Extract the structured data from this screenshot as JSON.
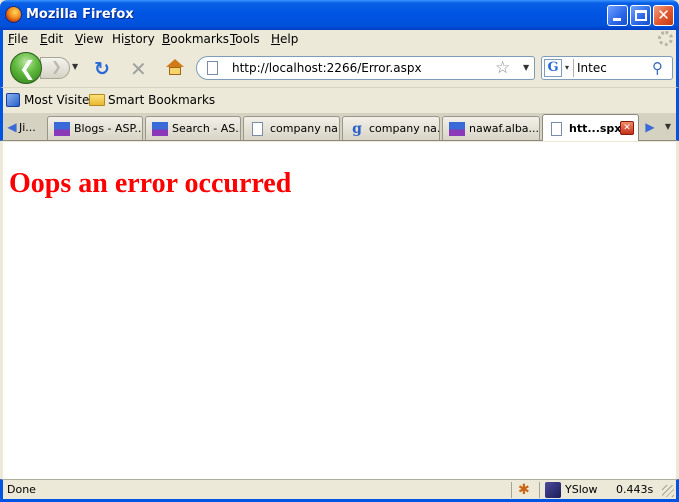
{
  "window": {
    "title": "Mozilla Firefox",
    "close_glyph": "✕"
  },
  "menu": {
    "items": [
      {
        "accel": "F",
        "rest": "ile"
      },
      {
        "accel": "E",
        "rest": "dit"
      },
      {
        "accel": "V",
        "rest": "iew"
      },
      {
        "pre": "Hi",
        "accel": "s",
        "rest": "tory"
      },
      {
        "accel": "B",
        "rest": "ookmarks"
      },
      {
        "accel": "T",
        "rest": "ools"
      },
      {
        "accel": "H",
        "rest": "elp"
      }
    ]
  },
  "nav": {
    "url": "http://localhost:2266/Error.aspx",
    "search_engine": "G",
    "search_query": "Intec"
  },
  "bookmarks": {
    "items": [
      "Most Visited",
      "Smart Bookmarks"
    ]
  },
  "tabs": {
    "first_partial": "Ji...",
    "items": [
      {
        "label": "Blogs - ASP....",
        "icon": "asp"
      },
      {
        "label": "Search - AS...",
        "icon": "asp"
      },
      {
        "label": "company na...",
        "icon": "page"
      },
      {
        "label": "company na...",
        "icon": "google"
      },
      {
        "label": "nawaf.alba...",
        "icon": "asp"
      },
      {
        "label": "htt...spx",
        "icon": "page",
        "active": true
      }
    ],
    "asp_icon_text": "ASP.net",
    "close_glyph": "✕"
  },
  "content": {
    "heading": "Oops an error occurred",
    "heading_color": "#ff0000"
  },
  "status": {
    "text": "Done",
    "yslow_label": "YSlow",
    "load_time": "0.443s"
  }
}
